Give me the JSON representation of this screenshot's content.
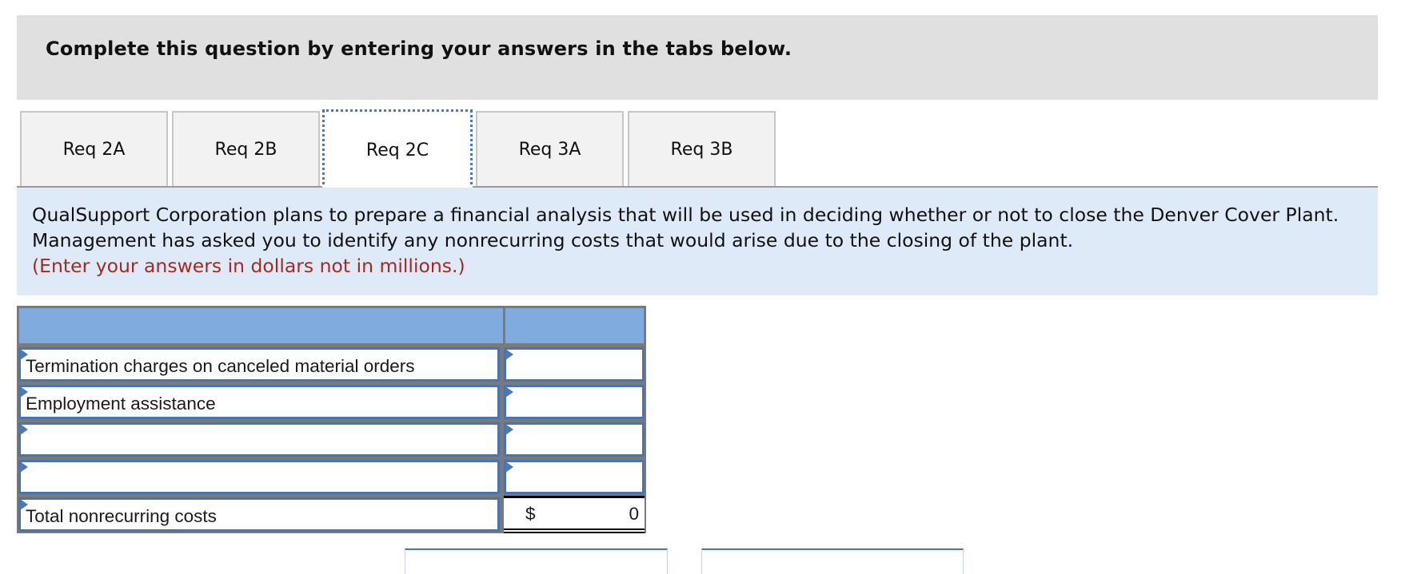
{
  "banner": {
    "instruction": "Complete this question by entering your answers in the tabs below."
  },
  "tabs": [
    {
      "label": "Req 2A",
      "active": false
    },
    {
      "label": "Req 2B",
      "active": false
    },
    {
      "label": "Req 2C",
      "active": true
    },
    {
      "label": "Req 3A",
      "active": false
    },
    {
      "label": "Req 3B",
      "active": false
    }
  ],
  "description": {
    "text": "QualSupport Corporation plans to prepare a financial analysis that will be used in deciding whether or not to close the Denver Cover Plant. Management has asked you to identify any nonrecurring costs that would arise due to the closing of the plant.",
    "note": "(Enter your answers in dollars not in millions.)"
  },
  "table": {
    "headers": [
      "",
      ""
    ],
    "rows": [
      {
        "label": "Termination charges on canceled material orders",
        "value": ""
      },
      {
        "label": "Employment assistance",
        "value": ""
      },
      {
        "label": "",
        "value": ""
      },
      {
        "label": "",
        "value": ""
      }
    ],
    "total": {
      "label": "Total nonrecurring costs",
      "currency": "$",
      "value": "0"
    }
  },
  "colors": {
    "banner_bg": "#e0e0e0",
    "description_bg": "#deeaf7",
    "note_red": "#a32a23",
    "table_header_bg": "#80abdf",
    "cell_border_blue": "#4a74ae"
  }
}
